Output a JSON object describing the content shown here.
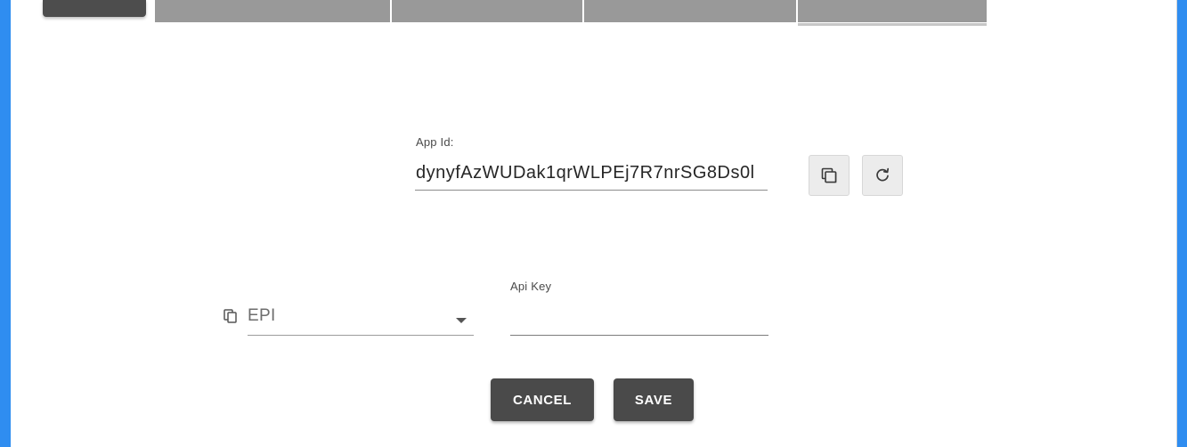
{
  "form": {
    "app_id_label": "App Id:",
    "app_id_value": "dynyfAzWUDak1qrWLPEj7R7nrSG8Ds0l",
    "source_select_value": "EPI",
    "api_key_label": "Api Key",
    "api_key_value": "",
    "cancel_label": "CANCEL",
    "save_label": "SAVE"
  },
  "icons": {
    "copy_button": "copy-icon",
    "refresh_button": "refresh-icon",
    "select_prefix": "copy-icon",
    "dropdown_arrow": "chevron-down-icon"
  },
  "colors": {
    "frame": "#2f8df0",
    "button_bg": "#4a4a4a",
    "tab_inactive": "#999999",
    "tab_active": "#4d4d4d"
  }
}
